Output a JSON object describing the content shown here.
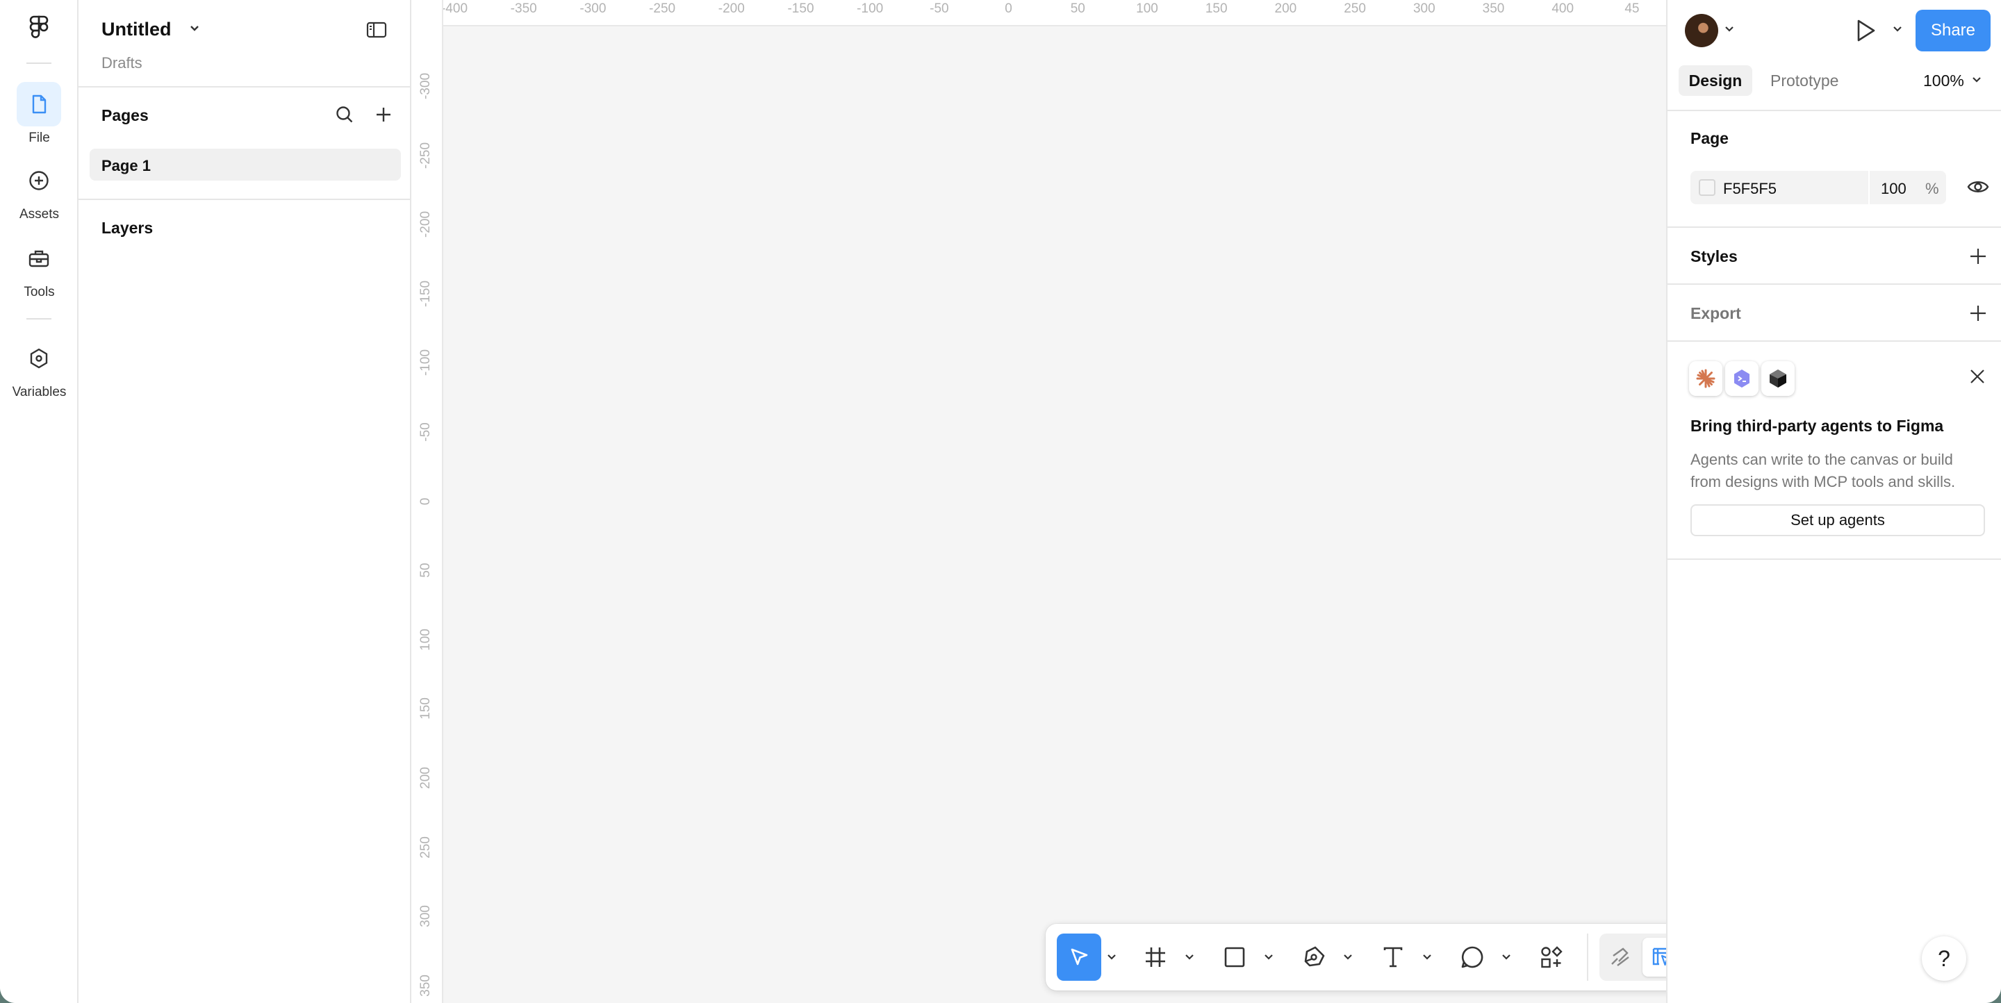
{
  "rail": {
    "items": [
      {
        "label": "File",
        "icon": "file-icon",
        "active": true
      },
      {
        "label": "Assets",
        "icon": "plus-circle-icon",
        "active": false
      },
      {
        "label": "Tools",
        "icon": "toolbox-icon",
        "active": false
      },
      {
        "label": "Variables",
        "icon": "hexagon-icon",
        "active": false
      }
    ]
  },
  "file": {
    "title": "Untitled",
    "location": "Drafts"
  },
  "pages": {
    "title": "Pages",
    "items": [
      "Page 1"
    ]
  },
  "layers": {
    "title": "Layers"
  },
  "rulers": {
    "horizontal": [
      "-400",
      "-350",
      "-300",
      "-250",
      "-200",
      "-150",
      "-100",
      "-50",
      "0",
      "50",
      "100",
      "150",
      "200",
      "250",
      "300",
      "350",
      "400",
      "45"
    ],
    "vertical": [
      "-300",
      "-250",
      "-200",
      "-150",
      "-100",
      "-50",
      "0",
      "50",
      "100",
      "150",
      "200",
      "250",
      "300",
      "350"
    ]
  },
  "canvas": {
    "background": "#F5F5F5"
  },
  "toolbar": {
    "tools": [
      "move-tool",
      "frame-tool",
      "rectangle-tool",
      "pen-tool",
      "text-tool",
      "comment-tool",
      "actions-tool"
    ],
    "modes": [
      "draw-mode",
      "design-mode",
      "dev-components-mode",
      "dev-mode"
    ],
    "accent": "#3B8FF5"
  },
  "header": {
    "share_label": "Share"
  },
  "tabs": {
    "design": "Design",
    "prototype": "Prototype",
    "zoom": "100%"
  },
  "page_section": {
    "title": "Page",
    "fill_hex": "F5F5F5",
    "opacity": "100",
    "opacity_unit": "%"
  },
  "styles": {
    "title": "Styles"
  },
  "export": {
    "title": "Export"
  },
  "promo": {
    "title": "Bring third-party agents to Figma",
    "body": "Agents can write to the canvas or build from designs with MCP tools and skills.",
    "button": "Set up agents"
  },
  "help": {
    "label": "?"
  }
}
